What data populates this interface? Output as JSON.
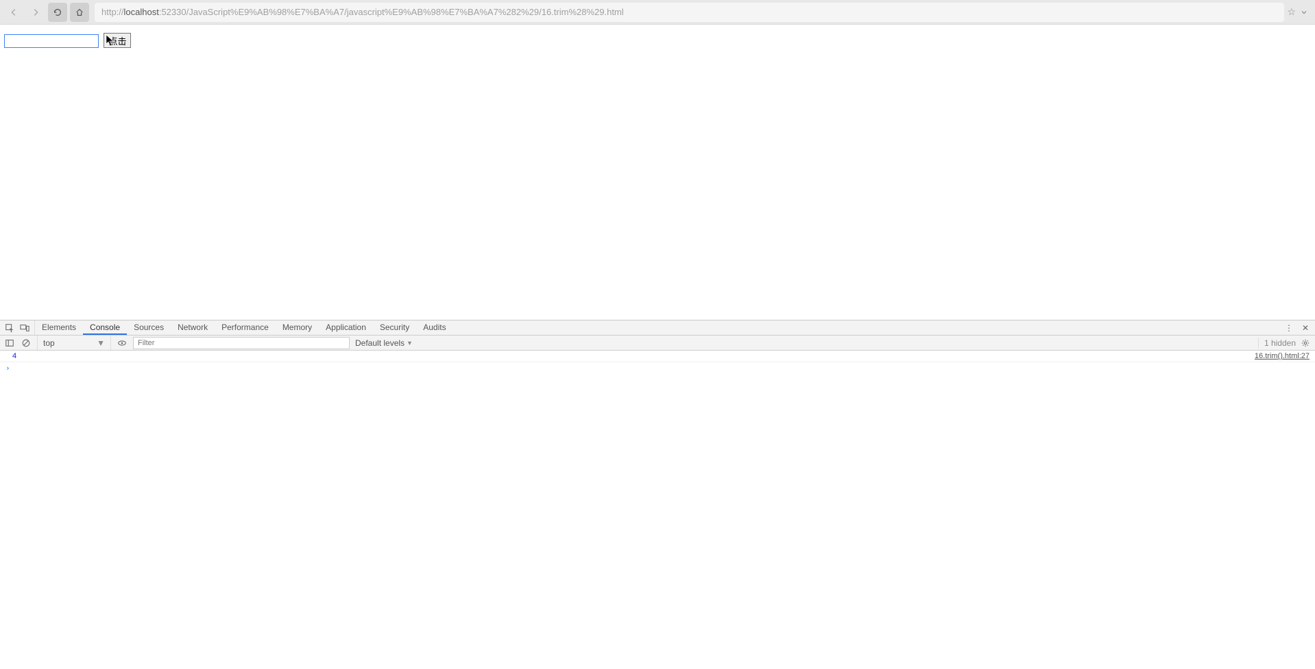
{
  "browser": {
    "url_prefix": "http://",
    "url_host": "localhost",
    "url_rest": ":52330/JavaScript%E9%AB%98%E7%BA%A7/javascript%E9%AB%98%E7%BA%A7%282%29/16.trim%28%29.html"
  },
  "page": {
    "input_value": "",
    "button_label": "点击"
  },
  "devtools": {
    "tabs": [
      "Elements",
      "Console",
      "Sources",
      "Network",
      "Performance",
      "Memory",
      "Application",
      "Security",
      "Audits"
    ],
    "active_tab": "Console",
    "console_toolbar": {
      "context": "top",
      "filter_placeholder": "Filter",
      "levels_label": "Default levels",
      "hidden_label": "1 hidden"
    },
    "console_output": {
      "value": "4",
      "source": "16.trim().html:27"
    }
  }
}
